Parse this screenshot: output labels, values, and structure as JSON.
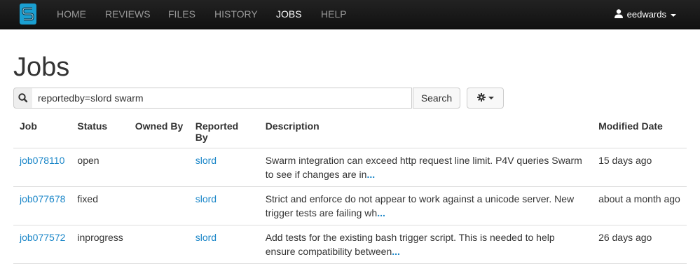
{
  "nav": {
    "items": [
      {
        "label": "HOME"
      },
      {
        "label": "REVIEWS"
      },
      {
        "label": "FILES"
      },
      {
        "label": "HISTORY"
      },
      {
        "label": "JOBS",
        "active": true
      },
      {
        "label": "HELP"
      }
    ],
    "user": "eedwards",
    "logo_icon": "swarm-logo-icon"
  },
  "page": {
    "title": "Jobs"
  },
  "search": {
    "icon": "search-icon",
    "value": "reportedby=slord swarm",
    "button_label": "Search",
    "options_icon": "gear-icon"
  },
  "table": {
    "headers": [
      "Job",
      "Status",
      "Owned By",
      "Reported By",
      "Description",
      "Modified Date"
    ],
    "rows": [
      {
        "job": "job078110",
        "status": "open",
        "owned_by": "",
        "reported_by": "slord",
        "description": "Swarm integration can exceed http request line limit. P4V queries Swarm to see if changes are in",
        "more": "...",
        "modified": "15 days ago"
      },
      {
        "job": "job077678",
        "status": "fixed",
        "owned_by": "",
        "reported_by": "slord",
        "description": "Strict and enforce do not appear to work against a unicode server. New trigger tests are failing wh",
        "more": "...",
        "modified": "about a month ago"
      },
      {
        "job": "job077572",
        "status": "inprogress",
        "owned_by": "",
        "reported_by": "slord",
        "description": "Add tests for the existing bash trigger script. This is needed to help ensure compatibility between",
        "more": "...",
        "modified": "26 days ago"
      }
    ]
  },
  "colors": {
    "navbar": "#1b1b1b",
    "link": "#1a86c8",
    "nav_inactive": "#999999",
    "nav_active": "#ffffff"
  }
}
